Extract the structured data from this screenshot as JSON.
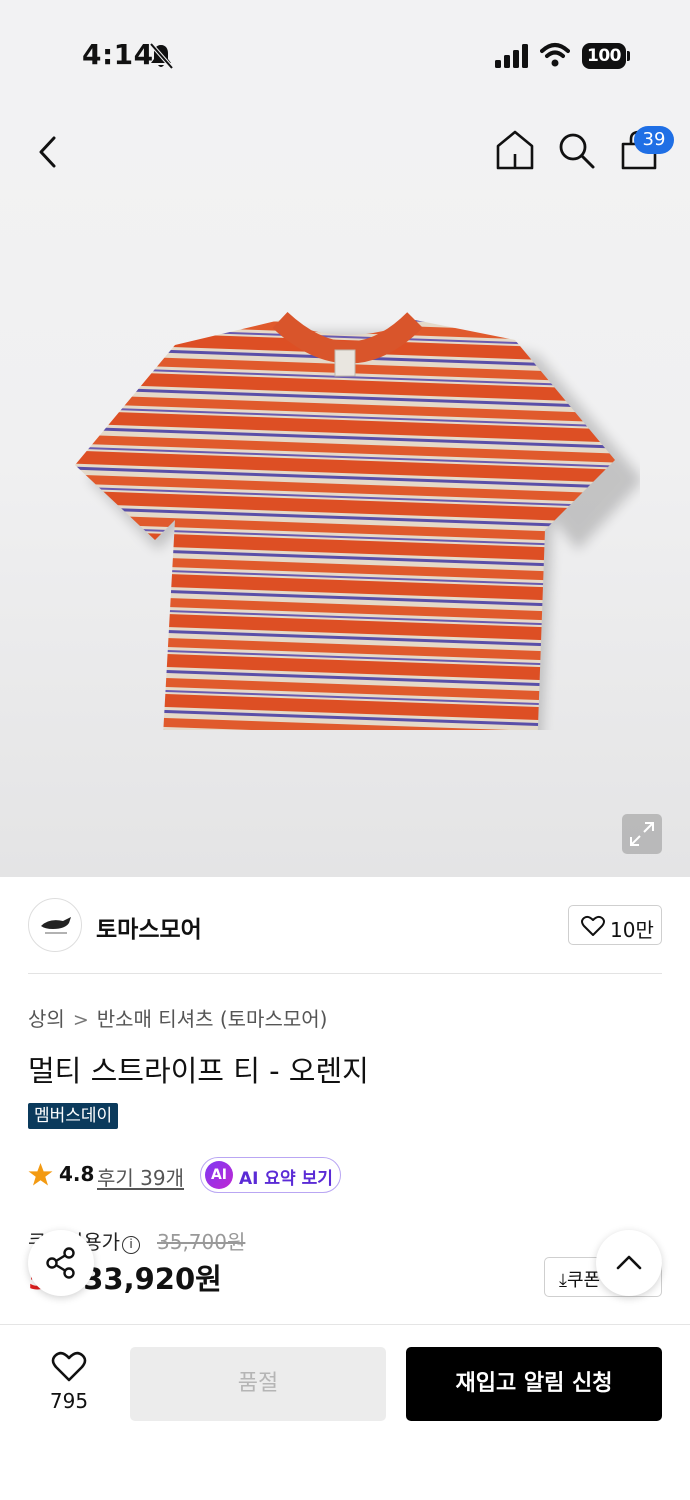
{
  "status_bar": {
    "time": "4:14",
    "battery": "100"
  },
  "nav": {
    "cart_count": "39"
  },
  "brand": {
    "name": "토마스모어",
    "likes": "10만"
  },
  "breadcrumb": {
    "category": "상의",
    "subcategory": "반소매 티셔츠 (토마스모어)"
  },
  "product": {
    "title": "멀티 스트라이프 티 - 오렌지",
    "tag": "멤버스데이",
    "rating": "4.8",
    "reviews": "후기 39개",
    "ai_summary": "AI 요약 보기",
    "ai_badge": "AI"
  },
  "pricing": {
    "coupon_label": "쿠폰적용가",
    "original_price": "35,700원",
    "discount": "5%",
    "sale_price": "33,920원",
    "coupon_button": "쿠폰"
  },
  "bottom_bar": {
    "wish_count": "795",
    "soldout_label": "품절",
    "restock_label": "재입고 알림 신청"
  },
  "colors": {
    "accent_blue": "#1f6fe5",
    "discount_red": "#e02020",
    "tag_navy": "#0b3a5c",
    "ai_purple": "#7e3af2",
    "star_orange": "#f39a12",
    "shirt_orange": "#e0522a"
  },
  "icons": [
    "bell-off-icon",
    "signal-icon",
    "wifi-icon",
    "battery-icon",
    "back-arrow-icon",
    "home-icon",
    "search-icon",
    "shopping-bag-icon",
    "expand-icon",
    "heart-icon",
    "star-icon",
    "info-icon",
    "share-icon",
    "chevron-up-icon",
    "download-icon"
  ]
}
